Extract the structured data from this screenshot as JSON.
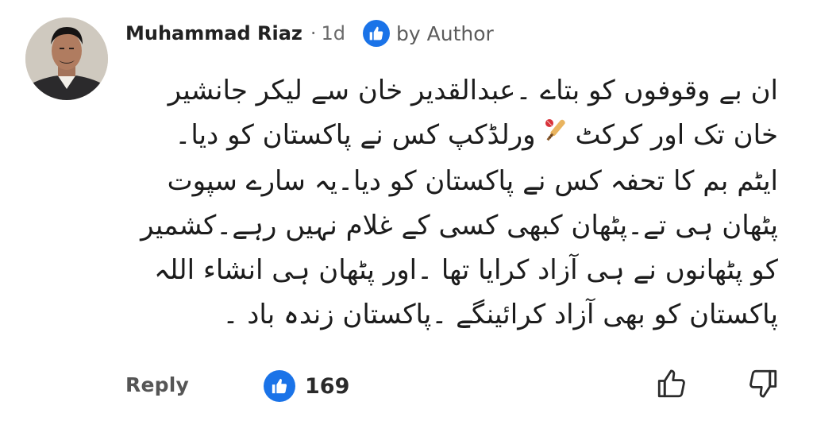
{
  "comment": {
    "author": "Muhammad Riaz",
    "separator": "·",
    "age": "1d",
    "badge": {
      "icon": "thumbs-up-icon",
      "label": "by Author",
      "color": "#1a73e8"
    },
    "avatar": {
      "icon": "avatar-photo"
    },
    "body_lines": [
      "ان بے وقوفوں کو بتاے ۔عبدالقدیر خان سے لیکر جانشیر",
      {
        "before": "خان تک اور کرکٹ",
        "emoji": "cricket-bat-icon",
        "after": "ورلڈکپ کس نے پاکستان کو دیا۔"
      },
      "ایٹم بم کا تحفہ کس نے پاکستان کو دیا۔یہ سارے سپوت",
      "پٹھان ہی تے۔پٹھان کبھی کسی کے غلام نہیں رہے۔کشمیر",
      "کو پٹھانوں نے ہی آزاد کرایا تھا ۔اور پٹھان ہی انشاء اللہ",
      "پاکستان کو بھی آزاد کرائینگے ۔پاکستان زندہ باد ۔"
    ]
  },
  "actions": {
    "reply_label": "Reply",
    "like_count": "169",
    "like_icon": "thumbs-up-icon",
    "thumb_up_icon": "thumbs-up-outline-icon",
    "thumb_down_icon": "thumbs-down-outline-icon"
  }
}
